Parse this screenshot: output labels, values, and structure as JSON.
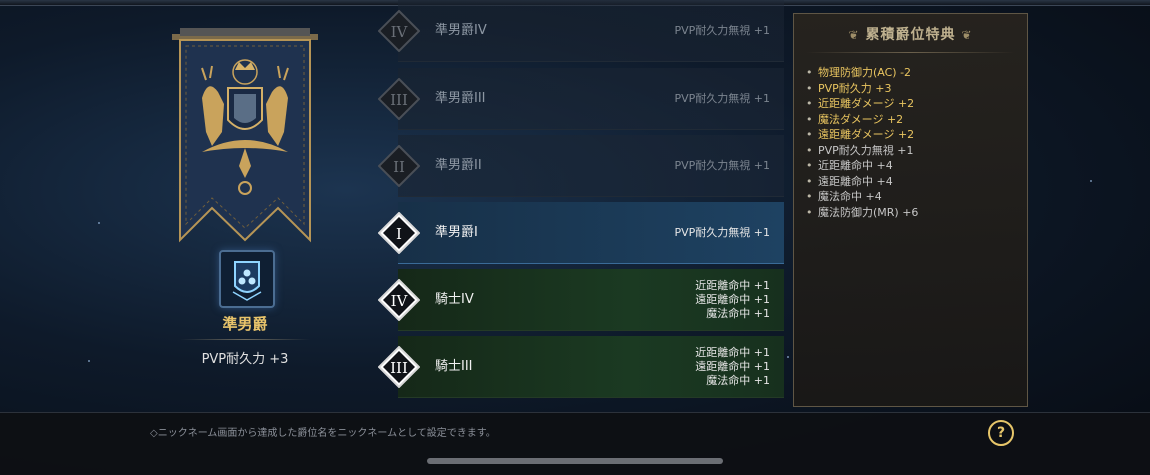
{
  "current_rank": {
    "name": "準男爵",
    "bonus": "PVP耐久力 +3",
    "icon": "shield-dots-icon"
  },
  "ranks": [
    {
      "numeral": "IV",
      "title": "準男爵IV",
      "state": "locked",
      "effects": [
        "PVP耐久力無視 +1"
      ]
    },
    {
      "numeral": "III",
      "title": "準男爵III",
      "state": "locked",
      "effects": [
        "PVP耐久力無視 +1"
      ]
    },
    {
      "numeral": "II",
      "title": "準男爵II",
      "state": "locked",
      "effects": [
        "PVP耐久力無視 +1"
      ]
    },
    {
      "numeral": "I",
      "title": "準男爵I",
      "state": "current",
      "effects": [
        "PVP耐久力無視 +1"
      ]
    },
    {
      "numeral": "IV",
      "title": "騎士IV",
      "state": "done",
      "effects": [
        "近距離命中 +1",
        "遠距離命中 +1",
        "魔法命中 +1"
      ]
    },
    {
      "numeral": "III",
      "title": "騎士III",
      "state": "done",
      "effects": [
        "近距離命中 +1",
        "遠距離命中 +1",
        "魔法命中 +1"
      ]
    }
  ],
  "benefits_panel": {
    "title": "累積爵位特典",
    "items": [
      {
        "text": "物理防御力(AC) -2",
        "highlight": true
      },
      {
        "text": "PVP耐久力 +3",
        "highlight": true
      },
      {
        "text": "近距離ダメージ +2",
        "highlight": true
      },
      {
        "text": "魔法ダメージ +2",
        "highlight": true
      },
      {
        "text": "遠距離ダメージ +2",
        "highlight": true
      },
      {
        "text": "PVP耐久力無視 +1",
        "highlight": false
      },
      {
        "text": "近距離命中 +4",
        "highlight": false
      },
      {
        "text": "遠距離命中 +4",
        "highlight": false
      },
      {
        "text": "魔法命中 +4",
        "highlight": false
      },
      {
        "text": "魔法防御力(MR) +6",
        "highlight": false
      }
    ]
  },
  "footer": {
    "note": "◇ニックネーム画面から達成した爵位名をニックネームとして設定できます。",
    "help_label": "?"
  },
  "colors": {
    "gold": "#e9c560",
    "current_row": "#1e4262",
    "done_row": "#1b3a22"
  }
}
